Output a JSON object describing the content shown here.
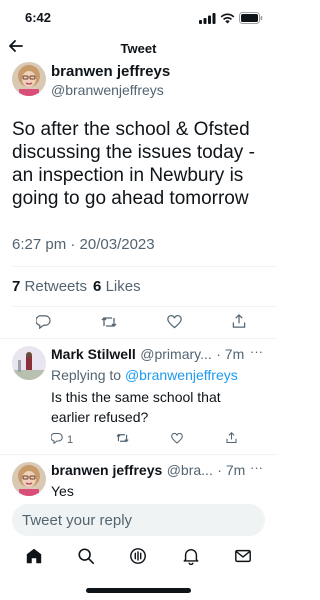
{
  "status_bar": {
    "time": "6:42"
  },
  "nav": {
    "title": "Tweet"
  },
  "tweet": {
    "author_name": "branwen jeffreys",
    "author_handle": "@branwenjeffreys",
    "text": "So after the school & Ofsted discussing the issues today - an inspection in Newbury is going to go ahead tomorrow",
    "timestamp": "6:27 pm · 20/03/2023",
    "retweet_count": "7",
    "retweet_label": "Retweets",
    "like_count": "6",
    "like_label": "Likes"
  },
  "replies": [
    {
      "author_name": "Mark Stilwell",
      "author_handle": "@primary...",
      "age": "· 7m",
      "replying_prefix": "Replying to",
      "replying_to": "@branwenjeffreys",
      "text_line1": "Is this the same school that",
      "text_line2": "earlier refused?",
      "reply_count": "1"
    },
    {
      "author_name": "branwen jeffreys",
      "author_handle": "@bra...",
      "age": "· 7m",
      "text": "Yes"
    }
  ],
  "reply_bar": {
    "placeholder": "Tweet your reply"
  },
  "colors": {
    "accent": "#1d9bf0",
    "secondary_text": "#536471",
    "primary_text": "#0f1419"
  },
  "icons": {
    "tab_bar": [
      "home-icon",
      "search-icon",
      "spaces-icon",
      "notifications-icon",
      "messages-icon"
    ],
    "actions": [
      "reply-icon",
      "retweet-icon",
      "like-icon",
      "share-icon"
    ]
  }
}
